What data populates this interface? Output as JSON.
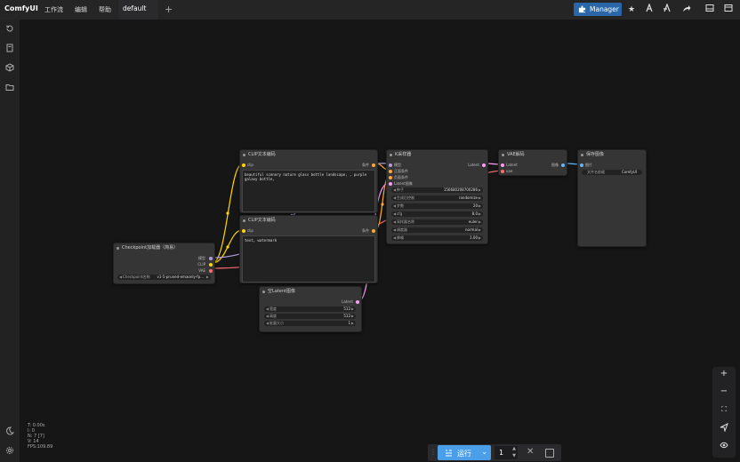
{
  "app": {
    "logo": "ComfyUI"
  },
  "menu": [
    "工作流",
    "编辑",
    "帮助"
  ],
  "tab": {
    "label": "default"
  },
  "toolbar": {
    "manager_label": "Manager"
  },
  "nodes": {
    "checkpoint": {
      "title": "Checkpoint加载器（简易）",
      "outputs": [
        "模型",
        "CLIP",
        "VAE"
      ],
      "widget_label": "Checkpoint名称",
      "widget_value": "v1-5-pruned-emaonly-fp..."
    },
    "clip_pos": {
      "title": "CLIP文本编码",
      "input": "clip",
      "output": "条件",
      "text": "beautiful scenery nature glass bottle landscape, , purple galaxy bottle,"
    },
    "clip_neg": {
      "title": "CLIP文本编码",
      "input": "clip",
      "output": "条件",
      "text": "text, watermark"
    },
    "latent": {
      "title": "空Latent图像",
      "output": "Latent",
      "widgets": [
        {
          "label": "宽度",
          "value": "512"
        },
        {
          "label": "高度",
          "value": "512"
        },
        {
          "label": "批量大小",
          "value": "1"
        }
      ]
    },
    "ksampler": {
      "title": "K采样器",
      "inputs": [
        "模型",
        "正面条件",
        "负面条件",
        "Latent图像"
      ],
      "output": "Latent",
      "widgets": [
        {
          "label": "种子",
          "value": "156680208700286"
        },
        {
          "label": "生成后控制",
          "value": "randomize"
        },
        {
          "label": "步数",
          "value": "20"
        },
        {
          "label": "cfg",
          "value": "8.0"
        },
        {
          "label": "采样器名称",
          "value": "euler"
        },
        {
          "label": "调度器",
          "value": "normal"
        },
        {
          "label": "降噪",
          "value": "1.00"
        }
      ]
    },
    "vae_decode": {
      "title": "VAE解码",
      "inputs": [
        "Latent",
        "vae"
      ],
      "output": "图像"
    },
    "save_image": {
      "title": "保存图像",
      "input": "图片",
      "widget_label": "文件名前缀",
      "widget_value": "ComfyUI"
    }
  },
  "stats": [
    "T: 0.00s",
    "I: 0",
    "N: 7 [7]",
    "V: 14",
    "FPS:109.89"
  ],
  "runbar": {
    "run_label": "运行",
    "count": "1"
  },
  "colors": {
    "accent": "#4a9fe8",
    "model": "#b39ddb",
    "clip": "#ffd500",
    "vae": "#ff6e6e",
    "latent": "#ff9cf9",
    "cond": "#ffa931",
    "image": "#64b5f6"
  }
}
